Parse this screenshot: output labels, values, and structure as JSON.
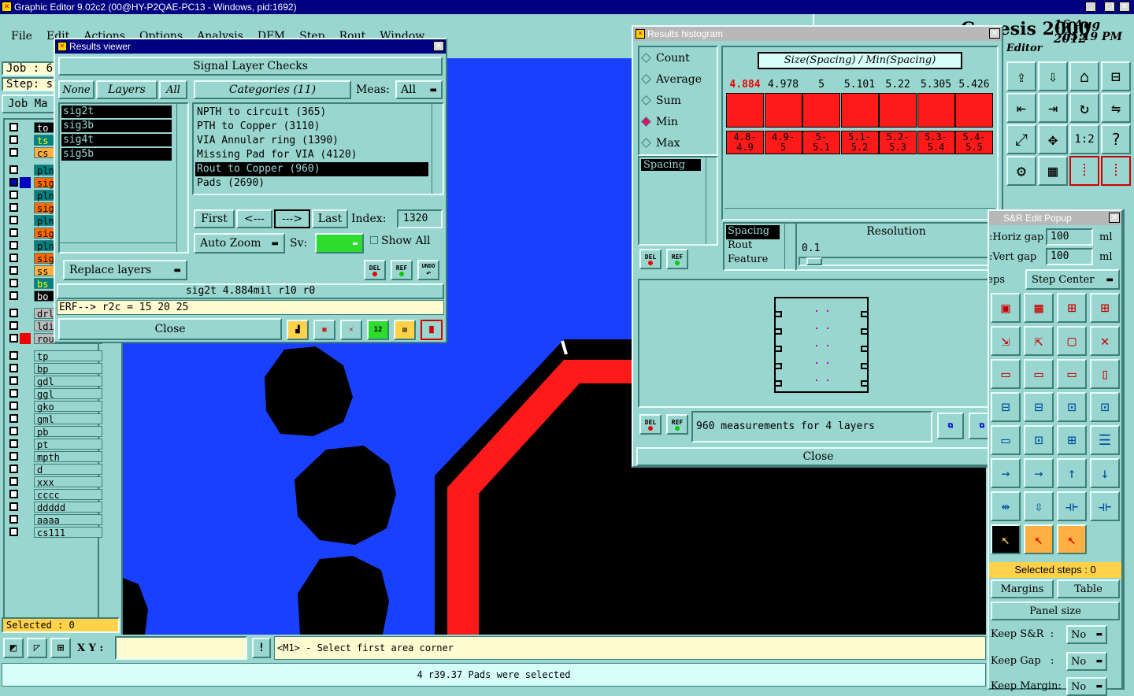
{
  "main_title": "Graphic Editor 9.02c2 (00@HY-P2QAE-PC13 - Windows, pid:1692)",
  "menu": [
    "File",
    "Edit",
    "Actions",
    "Options",
    "Analysis",
    "DFM",
    "Step",
    "Rout",
    "Window"
  ],
  "job_label": "Job : 6",
  "step_label": "Step: s",
  "job_matrix_label": "Job Ma",
  "layers": [
    {
      "name": "to",
      "color": "#000000",
      "text": "#ffffff"
    },
    {
      "name": "ts",
      "color": "#008080",
      "text": "#ffff00"
    },
    {
      "name": "cs",
      "color": "#ffb040",
      "text": "#000000"
    },
    {
      "name": "pln2",
      "color": "#008080",
      "text": "#000000"
    },
    {
      "name": "sig2",
      "color": "#ff6a00",
      "text": "#000000"
    },
    {
      "name": "pln3",
      "color": "#008080",
      "text": "#000000"
    },
    {
      "name": "sig3",
      "color": "#ff6a00",
      "text": "#000000"
    },
    {
      "name": "pln4",
      "color": "#008080",
      "text": "#000000"
    },
    {
      "name": "sig4",
      "color": "#ff6a00",
      "text": "#000000"
    },
    {
      "name": "pln5",
      "color": "#008080",
      "text": "#000000"
    },
    {
      "name": "sig5",
      "color": "#ff6a00",
      "text": "#000000"
    },
    {
      "name": "ss",
      "color": "#ffb040",
      "text": "#000000"
    },
    {
      "name": "bs",
      "color": "#008080",
      "text": "#ffff00"
    },
    {
      "name": "bo",
      "color": "#000000",
      "text": "#ffffff"
    },
    {
      "name": "drl",
      "color": "#bbbbbb",
      "text": "#000000"
    },
    {
      "name": "ldi",
      "color": "#bbbbbb",
      "text": "#000000"
    },
    {
      "name": "rout",
      "color": "#bbbbbb",
      "text": "#000000"
    },
    {
      "name": "tp",
      "color": "#9ad6d0",
      "text": "#000000"
    },
    {
      "name": "bp",
      "color": "#9ad6d0",
      "text": "#000000"
    },
    {
      "name": "gdl",
      "color": "#9ad6d0",
      "text": "#000000"
    },
    {
      "name": "ggl",
      "color": "#9ad6d0",
      "text": "#000000"
    },
    {
      "name": "gko",
      "color": "#9ad6d0",
      "text": "#000000"
    },
    {
      "name": "gml",
      "color": "#9ad6d0",
      "text": "#000000"
    },
    {
      "name": "pb",
      "color": "#9ad6d0",
      "text": "#000000"
    },
    {
      "name": "pt",
      "color": "#9ad6d0",
      "text": "#000000"
    },
    {
      "name": "mpth",
      "color": "#9ad6d0",
      "text": "#000000"
    },
    {
      "name": "d",
      "color": "#9ad6d0",
      "text": "#000000"
    },
    {
      "name": "xxx",
      "color": "#9ad6d0",
      "text": "#000000"
    },
    {
      "name": "cccc",
      "color": "#9ad6d0",
      "text": "#000000"
    },
    {
      "name": "ddddd",
      "color": "#9ad6d0",
      "text": "#000000"
    },
    {
      "name": "aaaa",
      "color": "#9ad6d0",
      "text": "#000000"
    },
    {
      "name": "cs111",
      "color": "#9ad6d0",
      "text": "#000000"
    }
  ],
  "selected_count": "Selected : 0",
  "status": {
    "xy_label": "X Y :",
    "xy_value": "",
    "hint": "<M1> - Select first area corner",
    "message": "4 r39.37 Pads were selected"
  },
  "results_viewer": {
    "title": "Results viewer",
    "header": "Signal Layer Checks",
    "none_btn": "None",
    "layers_btn": "Layers",
    "all_btn": "All",
    "layer_items": [
      "sig2t",
      "sig3b",
      "sig4t",
      "sig5b"
    ],
    "categories_btn": "Categories (11)",
    "meas_label": "Meas:",
    "meas_value": "All",
    "categories": [
      "NPTH to circuit (365)",
      "PTH to Copper (3110)",
      "VIA Annular ring (1390)",
      "Missing Pad for VIA (4120)",
      "Rout to Copper (960)",
      "Pads (2690)"
    ],
    "selected_category": 4,
    "replace_layers": "Replace layers",
    "first": "First",
    "prev": "<---",
    "next": "--->",
    "last": "Last",
    "index_label": "Index:",
    "index_value": "1320",
    "auto_zoom": "Auto Zoom",
    "sv_label": "Sv:",
    "show_all": "Show All",
    "del": "DEL",
    "ref": "REF",
    "undo": "UNDO",
    "info": "sig2t 4.884mil  r10  r0",
    "erf": "ERF--> r2c = 15 20 25",
    "close": "Close",
    "sv_color": "#2ddc2d"
  },
  "histogram": {
    "title": "Results histogram",
    "stats": [
      "Count",
      "Average",
      "Sum",
      "Min",
      "Max"
    ],
    "selected_stat": 3,
    "chart_title": "Size(Spacing) / Min(Spacing)",
    "values": [
      "4.884",
      "4.978",
      "5",
      "5.101",
      "5.22",
      "5.305",
      "5.426"
    ],
    "ranges": [
      [
        "4.8-",
        "4.9"
      ],
      [
        "4.9-",
        "5"
      ],
      [
        "5-",
        "5.1"
      ],
      [
        "5.1-",
        "5.2"
      ],
      [
        "5.2-",
        "5.3"
      ],
      [
        "5.3-",
        "5.4"
      ],
      [
        "5.4-",
        "5.5"
      ]
    ],
    "highlight_color": "#ff1a1a",
    "left_list": [
      "Spacing"
    ],
    "types": [
      "Spacing",
      "Rout",
      "Feature"
    ],
    "resolution_label": "Resolution",
    "resolution_value": "0.1",
    "del": "DEL",
    "ref": "REF",
    "measure_text": "960 measurements for 4 layers",
    "close": "Close"
  },
  "brand": {
    "name": "Genesis 2000",
    "subtitle": "Editor",
    "date": "16 Aug 2012",
    "time": "05:19 PM"
  },
  "sr_popup": {
    "title": "S&R Edit Popup",
    "horiz_gap_label": "Horiz gap:",
    "horiz_gap": "100",
    "vert_gap_label": "Vert gap:",
    "vert_gap": "100",
    "unit": "ml",
    "steps_label": "Steps:",
    "steps_value": "Step Center",
    "selected_steps": "Selected steps : 0",
    "margins": "Margins",
    "table": "Table",
    "panel_size": "Panel size",
    "keep_sr_label": "Keep S&R  :",
    "keep_sr": "No",
    "keep_gap_label": "Keep Gap   :",
    "keep_gap": "No",
    "keep_margin_label": "Keep Margin:",
    "keep_margin": "No"
  }
}
